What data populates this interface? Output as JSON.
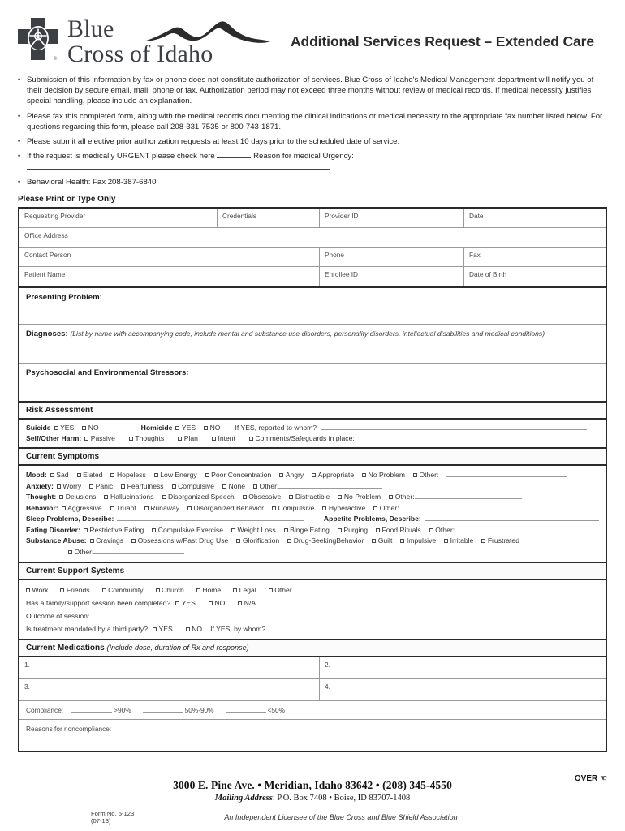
{
  "header": {
    "logo_line1": "Blue",
    "logo_line2": "Cross of Idaho",
    "logo_icon": "blue-cross-shield-logo",
    "title": "Additional Services Request – Extended Care"
  },
  "bullets": [
    "Submission of this information by fax or phone does not constitute authorization of services. Blue Cross of Idaho's Medical Management department will notify you of their decision by secure email, mail, phone or fax. Authorization period may not exceed three months without review of medical records. If medical necessity justifies special handling, please include an explanation.",
    "Please fax this completed form, along with the medical records documenting the clinical indications or medical necessity to the appropriate fax number listed below. For questions regarding this form, please call 208-331-7535 or 800-743-1871.",
    "Please submit all elective prior authorization requests at least 10 days prior to the scheduled date of service.",
    "Behavioral Health: Fax 208-387-6840"
  ],
  "urgent_bullet": {
    "prefix": "If the request is medically URGENT please check here",
    "middle": "Reason for medical Urgency:"
  },
  "print_only": "Please Print or Type Only",
  "provider_table": {
    "row1": [
      "Requesting Provider",
      "Credentials",
      "Provider ID",
      "Date"
    ],
    "row2": [
      "Office Address"
    ],
    "row3": [
      "Contact Person",
      "Phone",
      "Fax"
    ],
    "row4": [
      "Patient Name",
      "Enrollee ID",
      "Date of Birth"
    ]
  },
  "presenting_problem": {
    "label": "Presenting Problem:"
  },
  "diagnoses": {
    "label": "Diagnoses:",
    "note": "(List by name with accompanying code, include mental and substance use disorders, personality disorders, intellectual disabilities and medical conditions)"
  },
  "psychosocial": {
    "label": "Psychosocial and Environmental Stressors:"
  },
  "risk_assessment": {
    "band": "Risk Assessment",
    "suicide_label": "Suicide",
    "suicide_options": [
      "YES",
      "NO"
    ],
    "homicide_label": "Homicide",
    "homicide_options": [
      "YES",
      "NO"
    ],
    "reported_label": "If YES, reported to whom?",
    "harm_label": "Self/Other Harm:",
    "harm_options": [
      "Passive",
      "Thoughts",
      "Plan",
      "Intent",
      "Comments/Safeguards in place:"
    ]
  },
  "current_symptoms": {
    "band": "Current Symptoms",
    "mood_label": "Mood:",
    "mood_options": [
      "Sad",
      "Elated",
      "Hopeless",
      "Low Energy",
      "Poor Concentration",
      "Angry",
      "Appropriate",
      "No Problem"
    ],
    "anxiety_label": "Anxiety:",
    "anxiety_options": [
      "Worry",
      "Panic",
      "Fearfulness",
      "Compulsive",
      "None"
    ],
    "thought_label": "Thought:",
    "thought_options": [
      "Delusions",
      "Hallucinations",
      "Disorganized Speech",
      "Obsessive",
      "Distractible",
      "No Problem"
    ],
    "behavior_label": "Behavior:",
    "behavior_options": [
      "Aggressive",
      "Truant",
      "Runaway",
      "Disorganized Behavior",
      "Compulsive",
      "Hyperactive"
    ],
    "sleep_label": "Sleep Problems, Describe:",
    "appetite_label": "Appetite Problems, Describe:",
    "eating_label": "Eating Disorder:",
    "eating_options": [
      "Restrictive Eating",
      "Compulsive Exercise",
      "Weight Loss",
      "Binge Eating",
      "Purging",
      "Food Rituals"
    ],
    "substance_label": "Substance Abuse:",
    "substance_options": [
      "Cravings",
      "Obsessions w/Past Drug Use",
      "Glorification",
      "Drug-SeekingBehavior",
      "Guilt",
      "Impulsive",
      "Irritable",
      "Frustrated"
    ],
    "other_label": "Other:"
  },
  "support_systems": {
    "band": "Current Support Systems",
    "options": [
      "Work",
      "Friends",
      "Community",
      "Church",
      "Home",
      "Legal",
      "Other"
    ],
    "family_question": "Has a family/support session been completed?",
    "family_options": [
      "YES",
      "NO",
      "N/A"
    ],
    "outcome_label": "Outcome of session:",
    "mandated_question": "Is treatment mandated by a third party?",
    "mandated_options": [
      "YES",
      "NO"
    ],
    "mandated_followup": "If YES, by whom?"
  },
  "medications": {
    "band": "Current Medications",
    "band_note": "(Include dose, duration of Rx and response)",
    "items": [
      "1.",
      "2.",
      "3.",
      "4."
    ],
    "compliance_label": "Compliance:",
    "compliance_options": [
      ">90%",
      "50%-90%",
      "<50%"
    ],
    "noncompliance_label": "Reasons for noncompliance:"
  },
  "footer": {
    "address": "3000 E. Pine Ave.  •  Meridian, Idaho 83642 • (208) 345-4550",
    "mailing_prefix": "Mailing Address",
    "mailing_rest": ": P.O. Box 7408  •  Boise, ID 83707-1408",
    "form_number": "Form No. 5-123 (07-13)",
    "licensee": "An Independent Licensee of the Blue Cross and Blue Shield Association",
    "over": "OVER",
    "over_icon": "pointing-hand-icon"
  }
}
